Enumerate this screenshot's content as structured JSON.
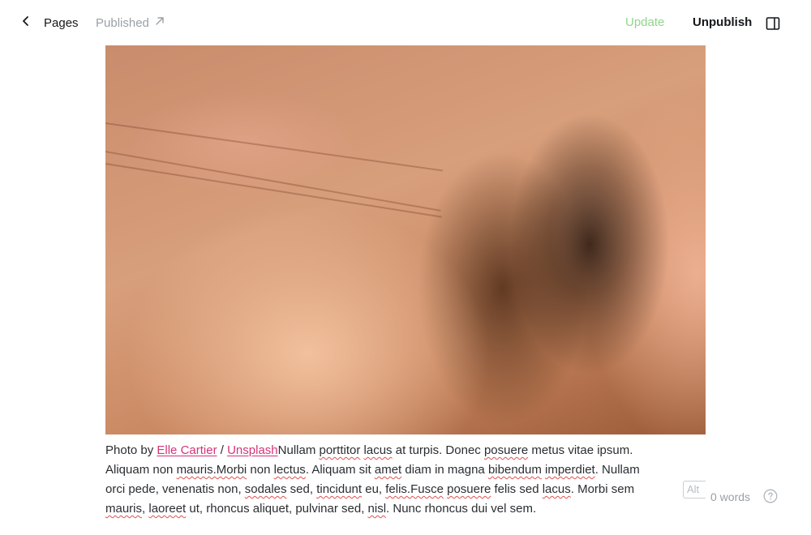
{
  "header": {
    "back_label": "Pages",
    "status_label": "Published",
    "update_label": "Update",
    "unpublish_label": "Unpublish"
  },
  "editor": {
    "caption": {
      "prefix": "Photo by ",
      "photographer": "Elle Cartier",
      "separator": " / ",
      "source": "Unsplash",
      "segments": [
        {
          "t": "Nullam",
          "s": false
        },
        {
          "t": " ",
          "s": false
        },
        {
          "t": "porttitor",
          "s": true
        },
        {
          "t": " ",
          "s": false
        },
        {
          "t": "lacus",
          "s": true
        },
        {
          "t": " at turpis. Donec ",
          "s": false
        },
        {
          "t": "posuere",
          "s": true
        },
        {
          "t": " metus vitae ipsum. Aliquam non ",
          "s": false
        },
        {
          "t": "mauris.Morbi",
          "s": true
        },
        {
          "t": " non ",
          "s": false
        },
        {
          "t": "lectus",
          "s": true
        },
        {
          "t": ". Aliquam sit ",
          "s": false
        },
        {
          "t": "amet",
          "s": true
        },
        {
          "t": " diam in magna ",
          "s": false
        },
        {
          "t": "bibendum",
          "s": true
        },
        {
          "t": " ",
          "s": false
        },
        {
          "t": "imperdiet",
          "s": true
        },
        {
          "t": ". Nullam orci pede, venenatis non, ",
          "s": false
        },
        {
          "t": "sodales",
          "s": true
        },
        {
          "t": " sed, ",
          "s": false
        },
        {
          "t": "tincidunt",
          "s": true
        },
        {
          "t": " eu, ",
          "s": false
        },
        {
          "t": "felis.Fusce",
          "s": true
        },
        {
          "t": " ",
          "s": false
        },
        {
          "t": "posuere",
          "s": true
        },
        {
          "t": " felis sed ",
          "s": false
        },
        {
          "t": "lacus",
          "s": true
        },
        {
          "t": ". Morbi sem ",
          "s": false
        },
        {
          "t": "mauris",
          "s": true
        },
        {
          "t": ", ",
          "s": false
        },
        {
          "t": "laoreet",
          "s": true
        },
        {
          "t": " ut, rhoncus aliquet, pulvinar sed, ",
          "s": false
        },
        {
          "t": "nisl",
          "s": true
        },
        {
          "t": ". Nunc rhoncus dui vel sem.",
          "s": false
        }
      ]
    },
    "alt_label": "Alt"
  },
  "footer": {
    "word_count": "0 words"
  },
  "icons": {
    "back": "chevron-left-icon",
    "status": "arrow-up-right-icon",
    "sidebar": "sidebar-toggle-icon",
    "help": "help-circle-icon"
  },
  "colors": {
    "update": "#8fd68b",
    "link": "#d6337a",
    "muted": "#9aa0a6",
    "spellcheck": "#e05050"
  }
}
